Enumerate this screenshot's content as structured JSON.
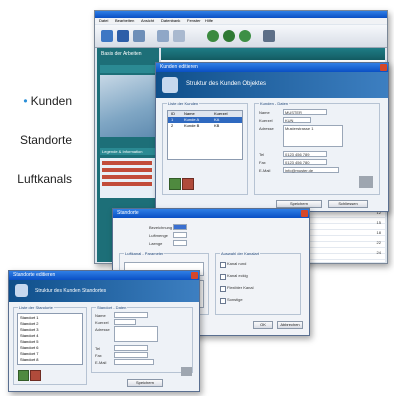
{
  "side_labels": {
    "bullet": "•",
    "customers": "Kunden",
    "locations": "Standorte",
    "ducts": "Luftkanals"
  },
  "main_window": {
    "menu": [
      "Datei",
      "Bearbeiten",
      "Ansicht",
      "Datenbank",
      "Fenster",
      "Hilfe"
    ],
    "left_panel_title": "Basis der Arbeiten",
    "tabs": [
      "Standorte"
    ],
    "legend_title": "Legende & Information",
    "status_numbers": [
      "7",
      "12",
      "15",
      "18",
      "22",
      "24"
    ]
  },
  "client_dialog": {
    "title": "Kunden editieren",
    "heading": "Struktur des Kunden Objektes",
    "list_group": "Liste der Kunden",
    "detail_group": "Kunden - Daten",
    "columns": [
      "ID",
      "Name",
      "Kuerzel"
    ],
    "rows": [
      [
        "1",
        "Kunde A",
        "KA"
      ],
      [
        "2",
        "Kunde B",
        "KB"
      ]
    ],
    "fields": [
      "Name",
      "Kuerzel",
      "Adresse",
      "Tel",
      "Fax",
      "E-Mail"
    ],
    "values": [
      "MUSTER",
      "KUN",
      "Musterstrasse 1",
      "0123 456 789",
      "0123 456 780",
      "info@muster.de"
    ],
    "buttons": [
      "Speichern",
      "Schliessen"
    ]
  },
  "middle_dialog": {
    "title": "Standorte",
    "fields": [
      "Bezeichnung",
      "Luftmenge",
      "Laenge"
    ],
    "group_left": "Luftkanal - Parameter",
    "group_right": "Auswahl der Kanalart",
    "checkboxes": [
      "Kanal rund",
      "Kanal eckig",
      "Flexibler Kanal",
      "Sonstige"
    ],
    "buttons": [
      "OK",
      "Abbrechen"
    ]
  },
  "bottom_dialog": {
    "title": "Standorte editieren",
    "heading": "Struktur des Kunden Standortes",
    "list_group": "Liste der Standorte",
    "detail_group": "Standort - Daten",
    "rows": [
      "Standort 1",
      "Standort 2",
      "Standort 3",
      "Standort 4",
      "Standort 5",
      "Standort 6",
      "Standort 7",
      "Standort 8"
    ],
    "fields": [
      "Name",
      "Kuerzel",
      "Adresse",
      "Tel",
      "Fax",
      "E-Mail"
    ],
    "buttons": [
      "Speichern"
    ]
  }
}
